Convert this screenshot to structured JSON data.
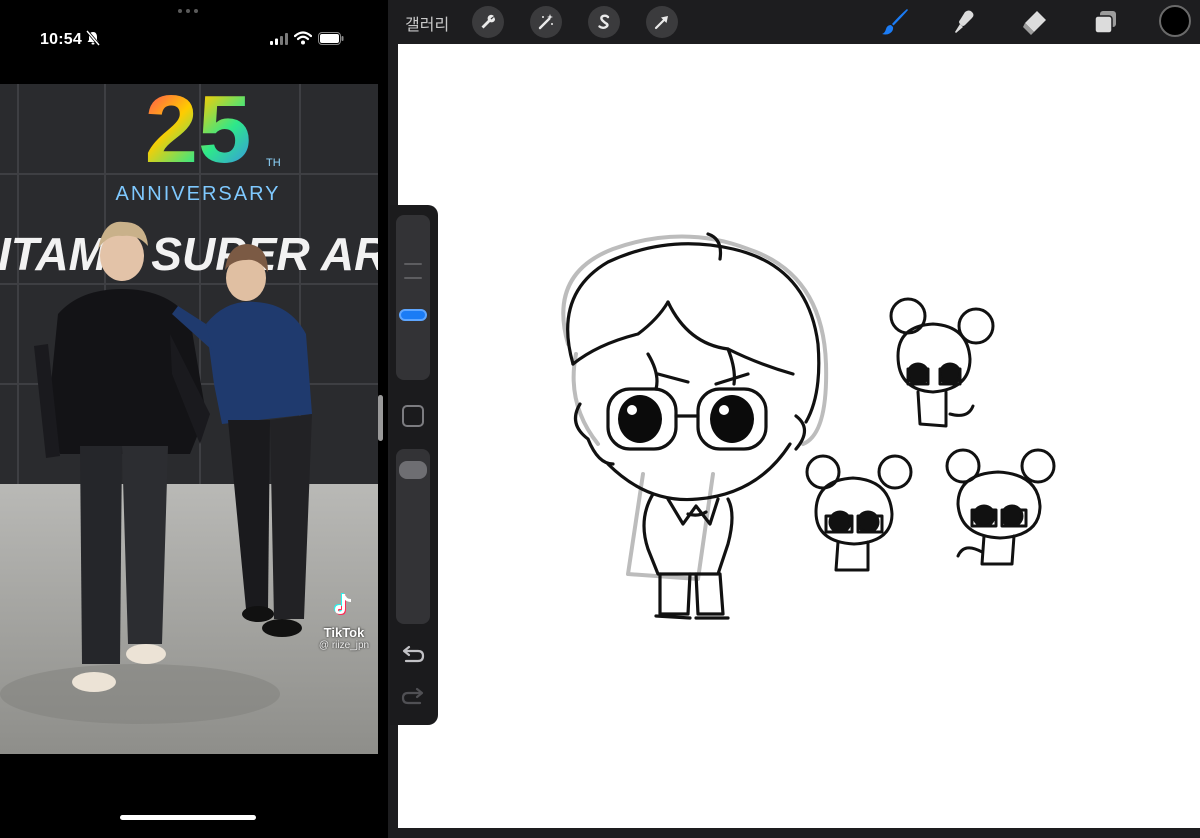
{
  "status_bar": {
    "time": "10:54",
    "icons": [
      "bell-slash-icon",
      "cellular-signal-icon",
      "wifi-icon",
      "battery-icon"
    ]
  },
  "video": {
    "sign_banner": "ANNIVERSARY",
    "sign_number": "25",
    "sign_suffix": "TH",
    "wall_text": "ITAMA SUPER AR",
    "watermark_name": "TikTok",
    "watermark_handle": "@ riize_jpn"
  },
  "procreate": {
    "gallery_label": "갤러리",
    "actions": [
      "wrench-icon",
      "magic-wand-icon",
      "selection-icon",
      "transform-arrow-icon"
    ],
    "tools": [
      "brush-icon",
      "smudge-icon",
      "eraser-icon",
      "layers-icon"
    ],
    "active_tool": "brush-icon",
    "current_color": "#000000",
    "accent_color": "#1b7cf5",
    "sidebar": [
      "brush-size-slider",
      "modify-button",
      "opacity-slider",
      "undo-icon",
      "redo-icon"
    ]
  }
}
